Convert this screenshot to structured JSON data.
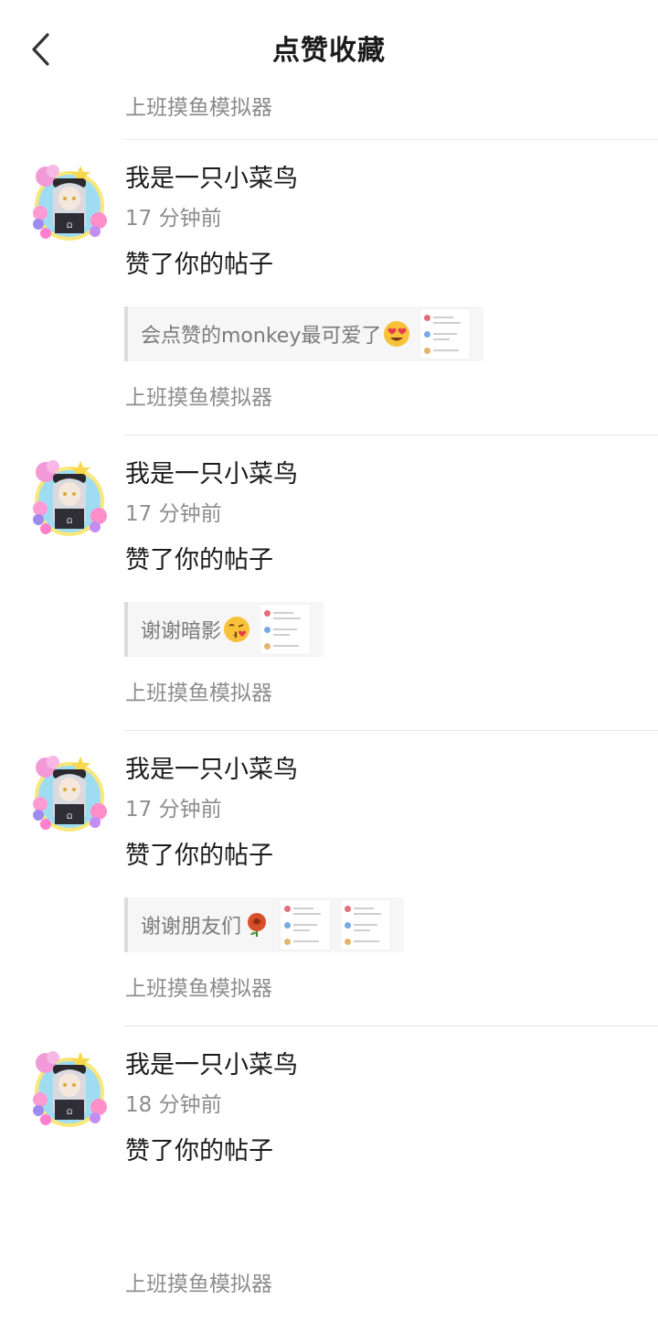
{
  "header": {
    "title": "点赞收藏",
    "back_icon": "chevron-left-icon"
  },
  "previous_item_source": "上班摸鱼模拟器",
  "items": [
    {
      "user": "我是一只小菜鸟",
      "time": "17 分钟前",
      "action": "赞了你的帖子",
      "quote": "会点赞的monkey最可爱了",
      "emoji": "heart-eyes-emoji",
      "thumbs": 1,
      "source": "上班摸鱼模拟器"
    },
    {
      "user": "我是一只小菜鸟",
      "time": "17 分钟前",
      "action": "赞了你的帖子",
      "quote": "谢谢暗影",
      "emoji": "kiss-emoji",
      "thumbs": 1,
      "source": "上班摸鱼模拟器"
    },
    {
      "user": "我是一只小菜鸟",
      "time": "17 分钟前",
      "action": "赞了你的帖子",
      "quote": "谢谢朋友们",
      "emoji": "rose-emoji",
      "thumbs": 2,
      "source": "上班摸鱼模拟器"
    },
    {
      "user": "我是一只小菜鸟",
      "time": "18 分钟前",
      "action": "赞了你的帖子",
      "quote": "",
      "emoji": "",
      "thumbs": 0,
      "source": "上班摸鱼模拟器"
    }
  ],
  "colors": {
    "divider": "#e6e6e6",
    "quote_bg": "#f6f6f6",
    "muted_text": "#8d8d8d"
  }
}
